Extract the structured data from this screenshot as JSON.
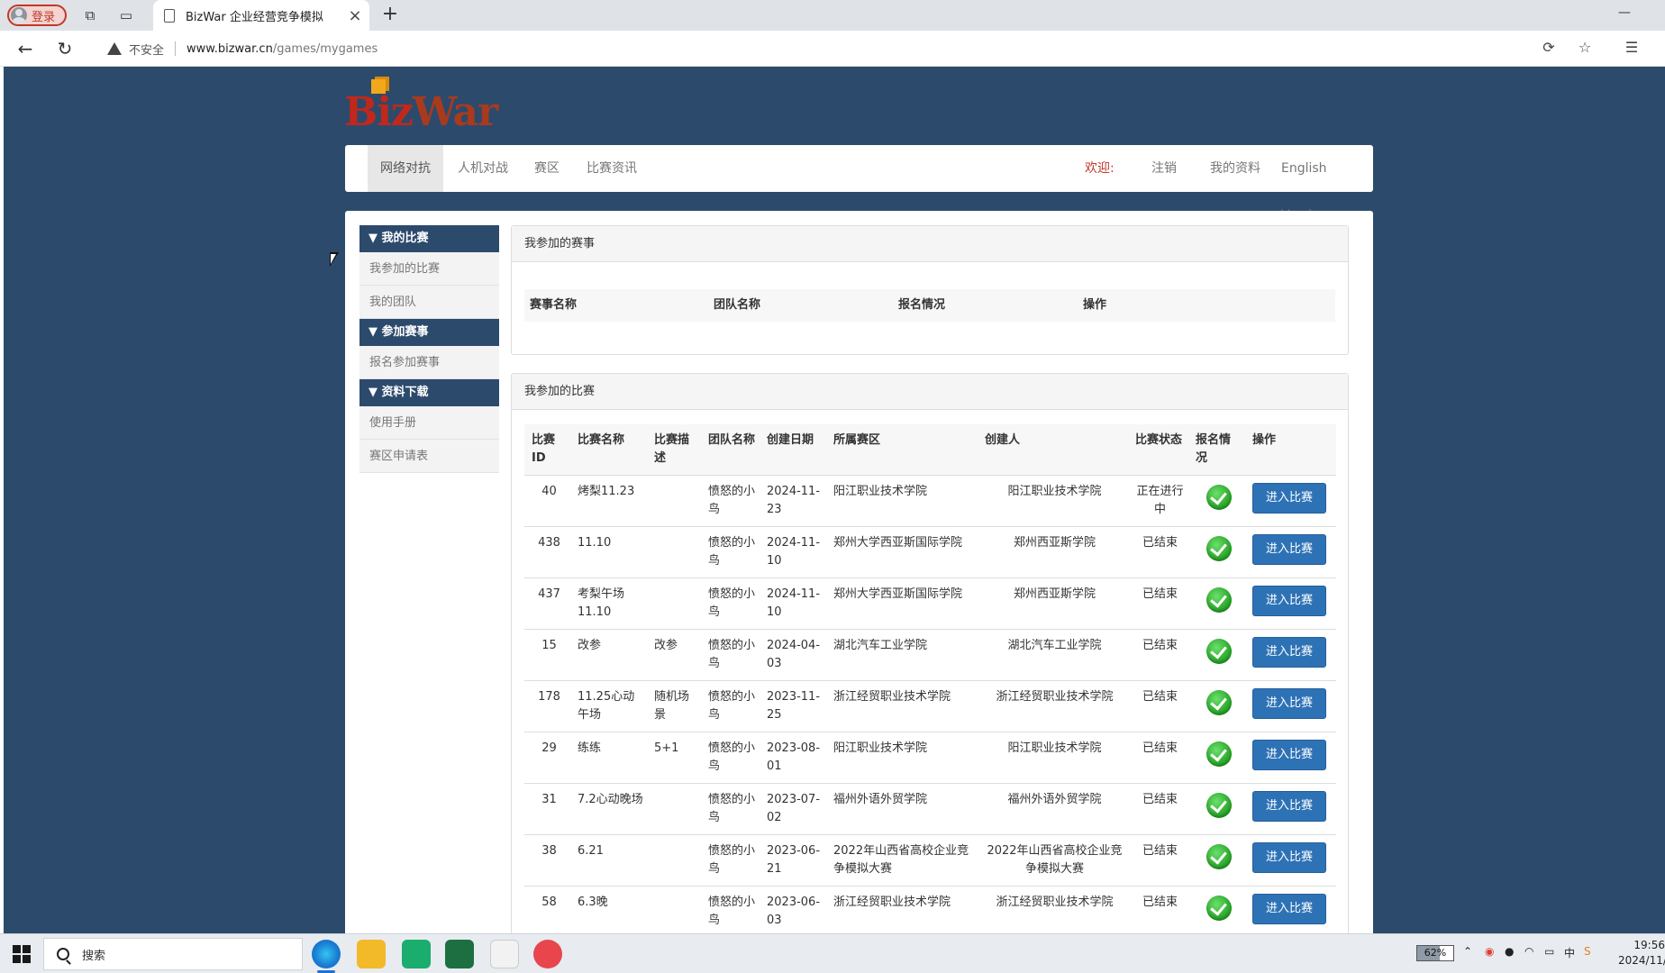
{
  "browser": {
    "profile_label": "登录",
    "tab_title": "BizWar 企业经营竞争模拟",
    "security_label": "不安全",
    "url_host": "www.bizwar.cn",
    "url_path": "/games/mygames"
  },
  "site": {
    "logo_text_a": "Biz",
    "logo_text_b": "War"
  },
  "topnav": {
    "items": [
      "网络对抗",
      "人机对战",
      "赛区",
      "比赛资讯"
    ],
    "welcome": "欢迎:",
    "logout": "注销",
    "profile": "我的资料",
    "english": "English Version"
  },
  "sidebar": {
    "sections": [
      {
        "title": "▼ 我的比赛",
        "items": [
          "我参加的比赛",
          "我的团队"
        ]
      },
      {
        "title": "▼ 参加赛事",
        "items": [
          "报名参加赛事"
        ]
      },
      {
        "title": "▼ 资料下载",
        "items": [
          "使用手册",
          "赛区申请表"
        ]
      }
    ]
  },
  "events_card": {
    "title": "我参加的赛事",
    "columns": [
      "赛事名称",
      "团队名称",
      "报名情况",
      "操作"
    ]
  },
  "games_card": {
    "title": "我参加的比赛",
    "columns": [
      "比赛ID",
      "比赛名称",
      "比赛描述",
      "团队名称",
      "创建日期",
      "所属赛区",
      "创建人",
      "比赛状态",
      "报名情况",
      "操作"
    ],
    "enter_label": "进入比赛",
    "rows": [
      {
        "id": "40",
        "name": "烤梨11.23",
        "desc": "",
        "team": "愤怒的小鸟",
        "date": "2024-11-23",
        "zone": "阳江职业技术学院",
        "creator": "阳江职业技术学院",
        "status": "正在进行中"
      },
      {
        "id": "438",
        "name": "11.10",
        "desc": "",
        "team": "愤怒的小鸟",
        "date": "2024-11-10",
        "zone": "郑州大学西亚斯国际学院",
        "creator": "郑州西亚斯学院",
        "status": "已结束"
      },
      {
        "id": "437",
        "name": "考梨午场11.10",
        "desc": "",
        "team": "愤怒的小鸟",
        "date": "2024-11-10",
        "zone": "郑州大学西亚斯国际学院",
        "creator": "郑州西亚斯学院",
        "status": "已结束"
      },
      {
        "id": "15",
        "name": "改参",
        "desc": "改参",
        "team": "愤怒的小鸟",
        "date": "2024-04-03",
        "zone": "湖北汽车工业学院",
        "creator": "湖北汽车工业学院",
        "status": "已结束"
      },
      {
        "id": "178",
        "name": "11.25心动午场",
        "desc": "随机场景",
        "team": "愤怒的小鸟",
        "date": "2023-11-25",
        "zone": "浙江经贸职业技术学院",
        "creator": "浙江经贸职业技术学院",
        "status": "已结束"
      },
      {
        "id": "29",
        "name": "练练",
        "desc": "5+1",
        "team": "愤怒的小鸟",
        "date": "2023-08-01",
        "zone": "阳江职业技术学院",
        "creator": "阳江职业技术学院",
        "status": "已结束"
      },
      {
        "id": "31",
        "name": "7.2心动晚场",
        "desc": "",
        "team": "愤怒的小鸟",
        "date": "2023-07-02",
        "zone": "福州外语外贸学院",
        "creator": "福州外语外贸学院",
        "status": "已结束"
      },
      {
        "id": "38",
        "name": "6.21",
        "desc": "",
        "team": "愤怒的小鸟",
        "date": "2023-06-21",
        "zone": "2022年山西省高校企业竞争模拟大赛",
        "creator": "2022年山西省高校企业竞争模拟大赛",
        "status": "已结束"
      },
      {
        "id": "58",
        "name": "6.3晚",
        "desc": "",
        "team": "愤怒的小鸟",
        "date": "2023-06-03",
        "zone": "浙江经贸职业技术学院",
        "creator": "浙江经贸职业技术学院",
        "status": "已结束"
      }
    ]
  },
  "taskbar": {
    "search_label": "搜索",
    "battery": "62%",
    "time": "19:56",
    "date": "2024/11/"
  },
  "colors": {
    "page_bg": "#2c4a6c",
    "brand_red": "#c0281c",
    "button_blue": "#2e72b6",
    "check_green": "#23a023"
  }
}
